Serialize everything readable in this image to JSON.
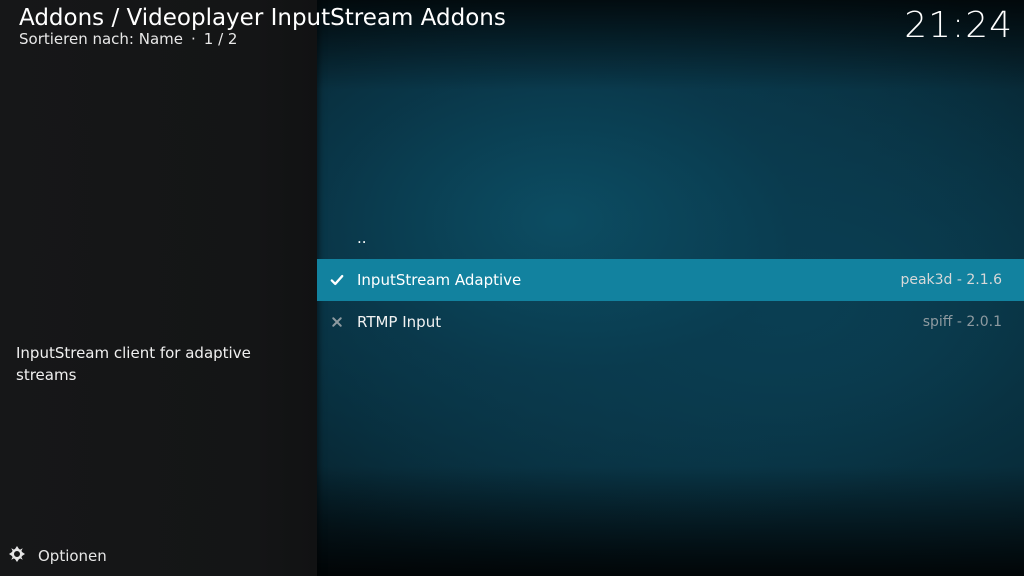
{
  "header": {
    "title": "Addons / Videoplayer InputStream Addons",
    "sort_label": "Sortieren nach: Name",
    "separator": "·",
    "page": "1 / 2"
  },
  "clock": "21:24",
  "description": "InputStream client for adaptive streams",
  "options": {
    "label": "Optionen",
    "icon": "options-gear-icon"
  },
  "list": {
    "parent": "..",
    "items": [
      {
        "label": "InputStream Adaptive",
        "meta": "peak3d - 2.1.6",
        "status_icon": "check-icon",
        "focused": true
      },
      {
        "label": "RTMP Input",
        "meta": "spiff - 2.0.1",
        "status_icon": "cross-icon",
        "focused": false
      }
    ]
  },
  "colors": {
    "focus": "#12829f",
    "left_panel": "#151617",
    "background": "#0b4358"
  }
}
